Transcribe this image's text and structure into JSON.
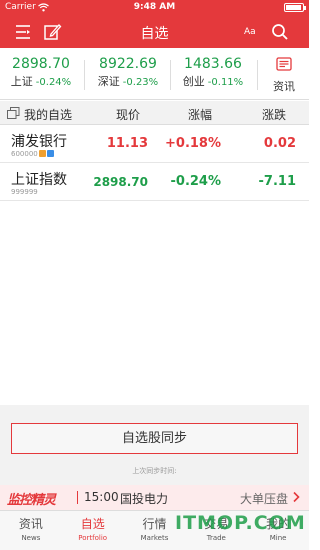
{
  "status_bar": {
    "carrier": "Carrier",
    "time": "9:48 AM"
  },
  "nav": {
    "title": "自选",
    "font_size_label": "Aa"
  },
  "indices": [
    {
      "value": "2898.70",
      "name": "上证",
      "change": "-0.24%"
    },
    {
      "value": "8922.69",
      "name": "深证",
      "change": "-0.23%"
    },
    {
      "value": "1483.66",
      "name": "创业",
      "change": "-0.11%"
    }
  ],
  "news_entry": {
    "label": "资讯"
  },
  "table": {
    "headers": {
      "name": "我的自选",
      "price": "现价",
      "change_pct": "涨幅",
      "change": "涨跌"
    },
    "rows": [
      {
        "name": "浦发银行",
        "code": "600000",
        "price": "11.13",
        "change_pct": "+0.18%",
        "change": "0.02",
        "trend": "up"
      },
      {
        "name": "上证指数",
        "code": "999999",
        "price": "2898.70",
        "change_pct": "-0.24%",
        "change": "-7.11",
        "trend": "down"
      }
    ]
  },
  "sync": {
    "button_label": "自选股同步",
    "last_sync_label": "上次同步时间:"
  },
  "ticker": {
    "logo": "监控精灵",
    "time": "15:00",
    "stock": "国投电力",
    "tag": "大单压盘"
  },
  "tabs": [
    {
      "cn": "资讯",
      "en": "News",
      "active": false
    },
    {
      "cn": "自选",
      "en": "Portfolio",
      "active": true
    },
    {
      "cn": "行情",
      "en": "Markets",
      "active": false
    },
    {
      "cn": "交易",
      "en": "Trade",
      "active": false
    },
    {
      "cn": "我的",
      "en": "Mine",
      "active": false
    }
  ],
  "watermark": "ITMOP.COM",
  "colors": {
    "brand_red": "#e4393c",
    "down_green": "#1e9e4a"
  }
}
